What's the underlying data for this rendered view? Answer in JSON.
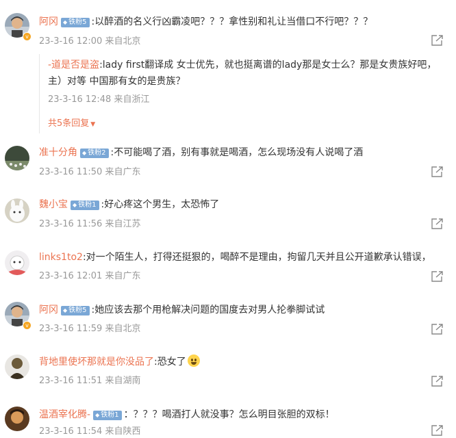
{
  "comments": [
    {
      "user": "阿冈",
      "badge": "铁粉5",
      "text": ":以醉酒的名义行凶霸凌吧？？？拿性别和礼让当借口不行吧？？？",
      "meta": "23-3-16 12:00 来自北京",
      "replies": [
        {
          "user": "-道是否是盗",
          "text": ":lady first翻译成 女士优先，就也挺离谱的lady那是女士么？那是女贵族好吧，",
          "text_cont": "主）对等 中国那有女的是贵族？",
          "meta": "23-3-16 12:48 来自浙江"
        }
      ],
      "more_replies": "共5条回复"
    },
    {
      "user": "准十分角",
      "badge": "铁粉2",
      "text": ":不可能喝了酒，别有事就是喝酒，怎么现场没有人说喝了酒",
      "meta": "23-3-16 11:50 来自广东"
    },
    {
      "user": "魏小宝",
      "badge": "铁粉1",
      "text": ":好心疼这个男生，太恐怖了",
      "meta": "23-3-16 11:56 来自江苏"
    },
    {
      "user": "links1to2",
      "text": ":对一个陌生人，打得还挺狠的，喝醉不是理由，拘留几天并且公开道歉承认错误，",
      "meta": "23-3-16 12:01 来自广东"
    },
    {
      "user": "阿冈",
      "badge": "铁粉5",
      "text": ":她应该去那个用枪解决问题的国度去对男人抡拳脚试试",
      "meta": "23-3-16 11:59 来自北京"
    },
    {
      "user": "背地里使坏那就是你没品了",
      "text": ":恐女了",
      "emoji": "crying-face-icon",
      "meta": "23-3-16 11:51 来自湖南"
    },
    {
      "user": "温酒宰化腾-",
      "badge": "铁粉1",
      "text": "：？？？喝酒打人就没事？怎么明目张胆的双标！",
      "meta": "23-3-16 11:54 来自陕西"
    }
  ],
  "colors": {
    "username": "#eb7350",
    "badge": "#7aa7d6",
    "meta": "#999999",
    "verified": "#f5a623"
  },
  "icons": {
    "share": "share-icon",
    "badge_diamond": "diamond-icon",
    "chevron": "chevron-down-icon"
  }
}
